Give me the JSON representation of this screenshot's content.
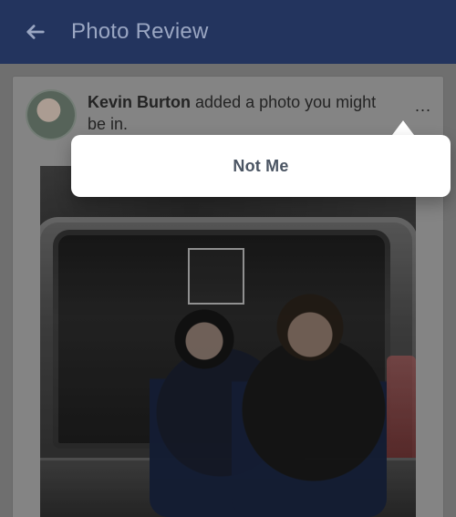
{
  "header": {
    "title": "Photo Review"
  },
  "post": {
    "user_name": "Kevin Burton",
    "action_text": "added a photo you might be in.",
    "more_label": "..."
  },
  "popup": {
    "option_label": "Not Me"
  },
  "colors": {
    "header_bg": "#23345e",
    "header_text": "#9aa6c2",
    "popup_bg": "#ffffff",
    "popup_text": "#4b5563"
  },
  "icons": {
    "back": "arrow-left",
    "more": "ellipsis-horizontal"
  }
}
